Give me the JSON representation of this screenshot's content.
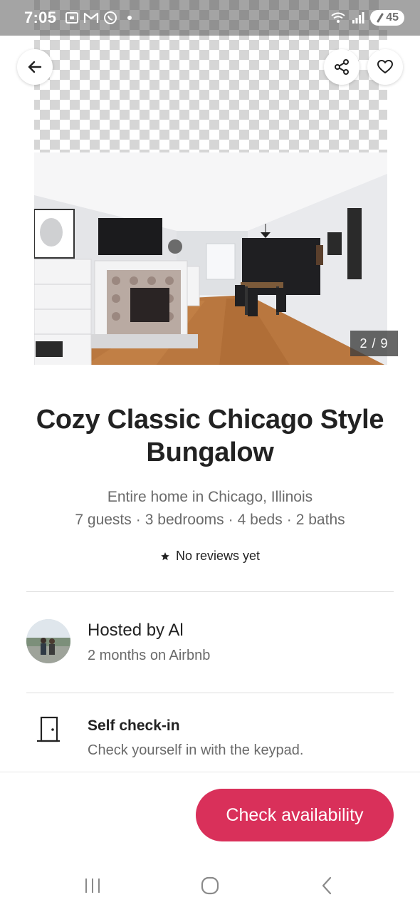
{
  "status_bar": {
    "time": "7:05",
    "battery": "45"
  },
  "photo": {
    "counter": "2 / 9"
  },
  "listing": {
    "title": "Cozy Classic Chicago Style Bungalow",
    "subtitle": "Entire home in Chicago, Illinois",
    "details": [
      "7 guests",
      "3 bedrooms",
      "4 beds",
      "2 baths"
    ],
    "separator": "·",
    "reviews": "No reviews yet"
  },
  "host": {
    "title": "Hosted by Al",
    "tenure": "2 months on Airbnb"
  },
  "highlight": {
    "title": "Self check-in",
    "description": "Check yourself in with the keypad."
  },
  "cta": {
    "label": "Check availability"
  },
  "colors": {
    "accent": "#d9305a",
    "text_primary": "#222222",
    "text_secondary": "#6a6a6a"
  },
  "icons": {
    "back": "arrow-left-icon",
    "share": "share-icon",
    "save": "heart-icon",
    "star": "star-icon",
    "door": "door-icon"
  }
}
